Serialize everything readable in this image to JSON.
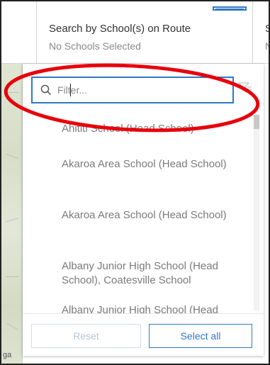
{
  "header": {
    "columns": [
      {
        "title": "Search by School(s) on Route",
        "subtitle": "No Schools Selected"
      },
      {
        "title": "S",
        "subtitle": "N"
      }
    ]
  },
  "filter": {
    "placeholder": "Filter...",
    "value": ""
  },
  "schools": [
    "Ahititi School (Head School)",
    "Akaroa Area School (Head School)",
    "Akaroa Area School (Head School)",
    "Albany Junior High School (Head School), Coatesville School",
    "Albany Junior High School (Head"
  ],
  "map": {
    "label": "ga"
  },
  "footer": {
    "reset_label": "Reset",
    "select_all_label": "Select all"
  },
  "colors": {
    "accent": "#2f78c4",
    "annotation": "#e8000b",
    "muted_text": "#7a7a7a"
  },
  "icons": {
    "search": "search-icon",
    "filter_options": "funnel-icon"
  }
}
